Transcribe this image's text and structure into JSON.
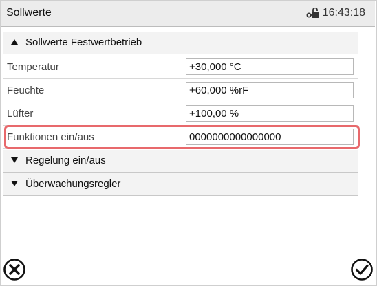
{
  "header": {
    "title": "Sollwerte",
    "time": "16:43:18",
    "lock_icon": "unlock-key-icon"
  },
  "sections": {
    "festwert": {
      "label": "Sollwerte Festwertbetrieb",
      "icon": "triangle-up-icon"
    },
    "regelung": {
      "label": "Regelung ein/aus",
      "icon": "triangle-down-icon"
    },
    "ueberwachung": {
      "label": "Überwachungsregler",
      "icon": "triangle-down-icon"
    }
  },
  "rows": [
    {
      "label": "Temperatur",
      "value": "+30,000 °C"
    },
    {
      "label": "Feuchte",
      "value": "+60,000 %rF"
    },
    {
      "label": "Lüfter",
      "value": "+100,00 %"
    },
    {
      "label": "Funktionen ein/aus",
      "value": "0000000000000000"
    }
  ],
  "footer": {
    "cancel_icon": "cancel-circle-icon",
    "confirm_icon": "confirm-check-icon"
  },
  "colors": {
    "highlight": "#e8696c",
    "header_bg": "#ececec",
    "section_bg": "#f3f3f3"
  }
}
